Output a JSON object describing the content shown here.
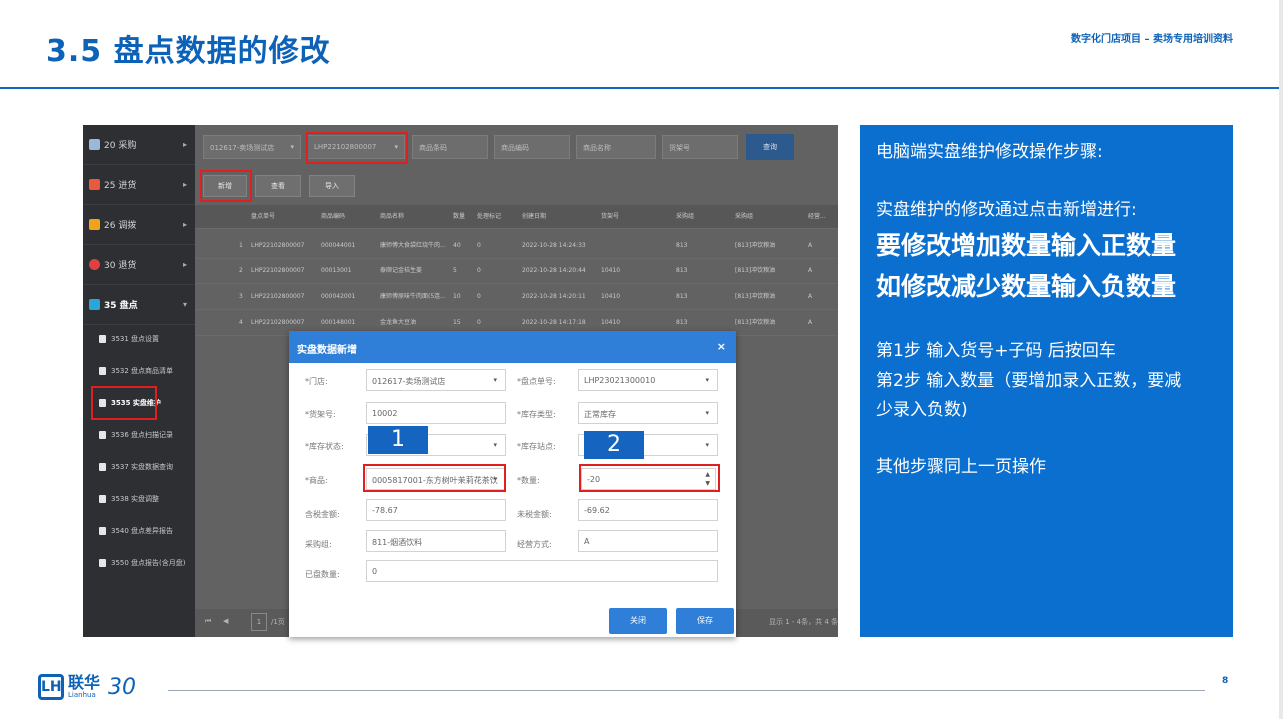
{
  "header": {
    "title": "3.5 盘点数据的修改",
    "subtitle": "数字化门店项目 – 卖场专用培训资料"
  },
  "sidebar": {
    "items": [
      {
        "label": "20 采购",
        "color": "#9ab8d8"
      },
      {
        "label": "25 进货",
        "color": "#e85a3b"
      },
      {
        "label": "26 调拨",
        "color": "#f2a21b"
      },
      {
        "label": "30 退货",
        "color": "#e04040"
      },
      {
        "label": "35 盘点",
        "color": "#2aa6d6"
      }
    ],
    "subitems": [
      "3531 盘点设置",
      "3532 盘点商品清单",
      "3535 实盘维护",
      "3536 盘点扫描记录",
      "3537 实盘数据查询",
      "3538 实盘调整",
      "3540 盘点差异报告",
      "3550 盘点报告(含月盘)"
    ]
  },
  "toolbar": {
    "store": "012617-卖场测试店",
    "count_no": "LHP22102800007",
    "barcode_placeholder": "商品条码",
    "code_placeholder": "商品编码",
    "name_placeholder": "商品名称",
    "shelf_placeholder": "货架号",
    "query": "查询",
    "add": "新增",
    "view": "查看",
    "import": "导入"
  },
  "grid": {
    "columns": [
      "盘点单号",
      "商品编码",
      "商品名称",
      "数量",
      "处理标记",
      "创建日期",
      "货架号",
      "采购组",
      "采购组",
      "经营..."
    ],
    "rows": [
      [
        "1",
        "LHP22102800007",
        "000044001",
        "康师傅大食袋红烧牛肉...",
        "40",
        "0",
        "2022-10-28 14:24:33",
        "",
        "813",
        "[813]冲饮粮油",
        "A"
      ],
      [
        "2",
        "LHP22102800007",
        "00013001",
        "泰顺记金桔生姜",
        "5",
        "0",
        "2022-10-28 14:20:44",
        "10410",
        "813",
        "[813]冲饮粮油",
        "A"
      ],
      [
        "3",
        "LHP22102800007",
        "000042001",
        "康师傅原味牛肉面(5连...",
        "10",
        "0",
        "2022-10-28 14:20:11",
        "10410",
        "813",
        "[813]冲饮粮油",
        "A"
      ],
      [
        "4",
        "LHP22102800007",
        "000148001",
        "金龙鱼大豆油",
        "15",
        "0",
        "2022-10-28 14:17:18",
        "10410",
        "813",
        "[813]冲饮粮油",
        "A"
      ]
    ]
  },
  "pager": {
    "page": "1",
    "total_pages": "/1页",
    "summary": "显示 1 - 4条，共 4 条"
  },
  "dialog": {
    "title": "实盘数据新增",
    "close": "×",
    "store_label": "*门店:",
    "store_value": "012617-卖场测试店",
    "count_no_label": "*盘点单号:",
    "count_no_value": "LHP23021300010",
    "shelf_label": "*货架号:",
    "shelf_value": "10002",
    "stock_type_label": "*库存类型:",
    "stock_type_value": "正常库存",
    "stock_status_label": "*库存状态:",
    "stock_site_label": "*库存站点:",
    "product_label": "*商品:",
    "product_value": "0005817001-东方树叶茉莉花茶饮",
    "qty_label": "*数量:",
    "qty_value": "-20",
    "tax_amount_label": "含税金额:",
    "tax_amount_value": "-78.67",
    "notax_amount_label": "未税金额:",
    "notax_amount_value": "-69.62",
    "purchase_group_label": "采购组:",
    "purchase_group_value": "811-烟酒饮料",
    "biz_mode_label": "经营方式:",
    "biz_mode_value": "A",
    "counted_label": "已盘数量:",
    "counted_value": "0",
    "close_btn": "关闭",
    "save_btn": "保存"
  },
  "badges": {
    "one": "1",
    "two": "2"
  },
  "panel": {
    "intro": "电脑端实盘维护修改操作步骤:",
    "line2": "实盘维护的修改通过点击新增进行:",
    "big1": "要修改增加数量输入正数量",
    "big2": "如修改减少数量输入负数量",
    "step1": "第1步  输入货号+子码 后按回车",
    "step2a": "第2步  输入数量（要增加录入正数，要减",
    "step2b": "少录入负数)",
    "other": "其他步骤同上一页操作"
  },
  "footer": {
    "logo_cn": "联华",
    "logo_en": "Lianhua",
    "logo_30": "30",
    "page": "8"
  },
  "colors": {
    "brand": "#0d62b7",
    "panel": "#0b6fcf",
    "highlight": "#e02020"
  }
}
